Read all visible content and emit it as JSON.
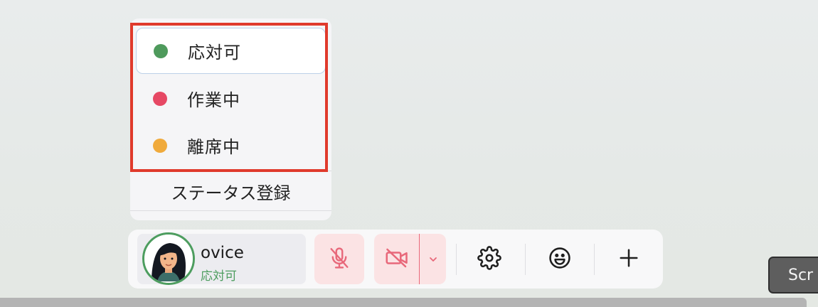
{
  "status_menu": {
    "options": [
      {
        "label": "応対可",
        "color": "#4e9a5c",
        "selected": true
      },
      {
        "label": "作業中",
        "color": "#e64864"
      },
      {
        "label": "離席中",
        "color": "#f0aa3c"
      }
    ],
    "register_label": "ステータス登録"
  },
  "toolbar": {
    "user": {
      "name": "ovice",
      "status": "応対可",
      "avatar_icon": "user-avatar-icon"
    },
    "mic_icon": "mic-off-icon",
    "camera_icon": "camera-off-icon",
    "camera_menu_icon": "chevron-down-icon",
    "settings_icon": "gear-icon",
    "emoji_icon": "smiley-icon",
    "add_icon": "plus-icon",
    "muted_color": "#e8687a",
    "status_color": "#4d9d5f"
  },
  "screen_button": {
    "label": "Scr"
  }
}
